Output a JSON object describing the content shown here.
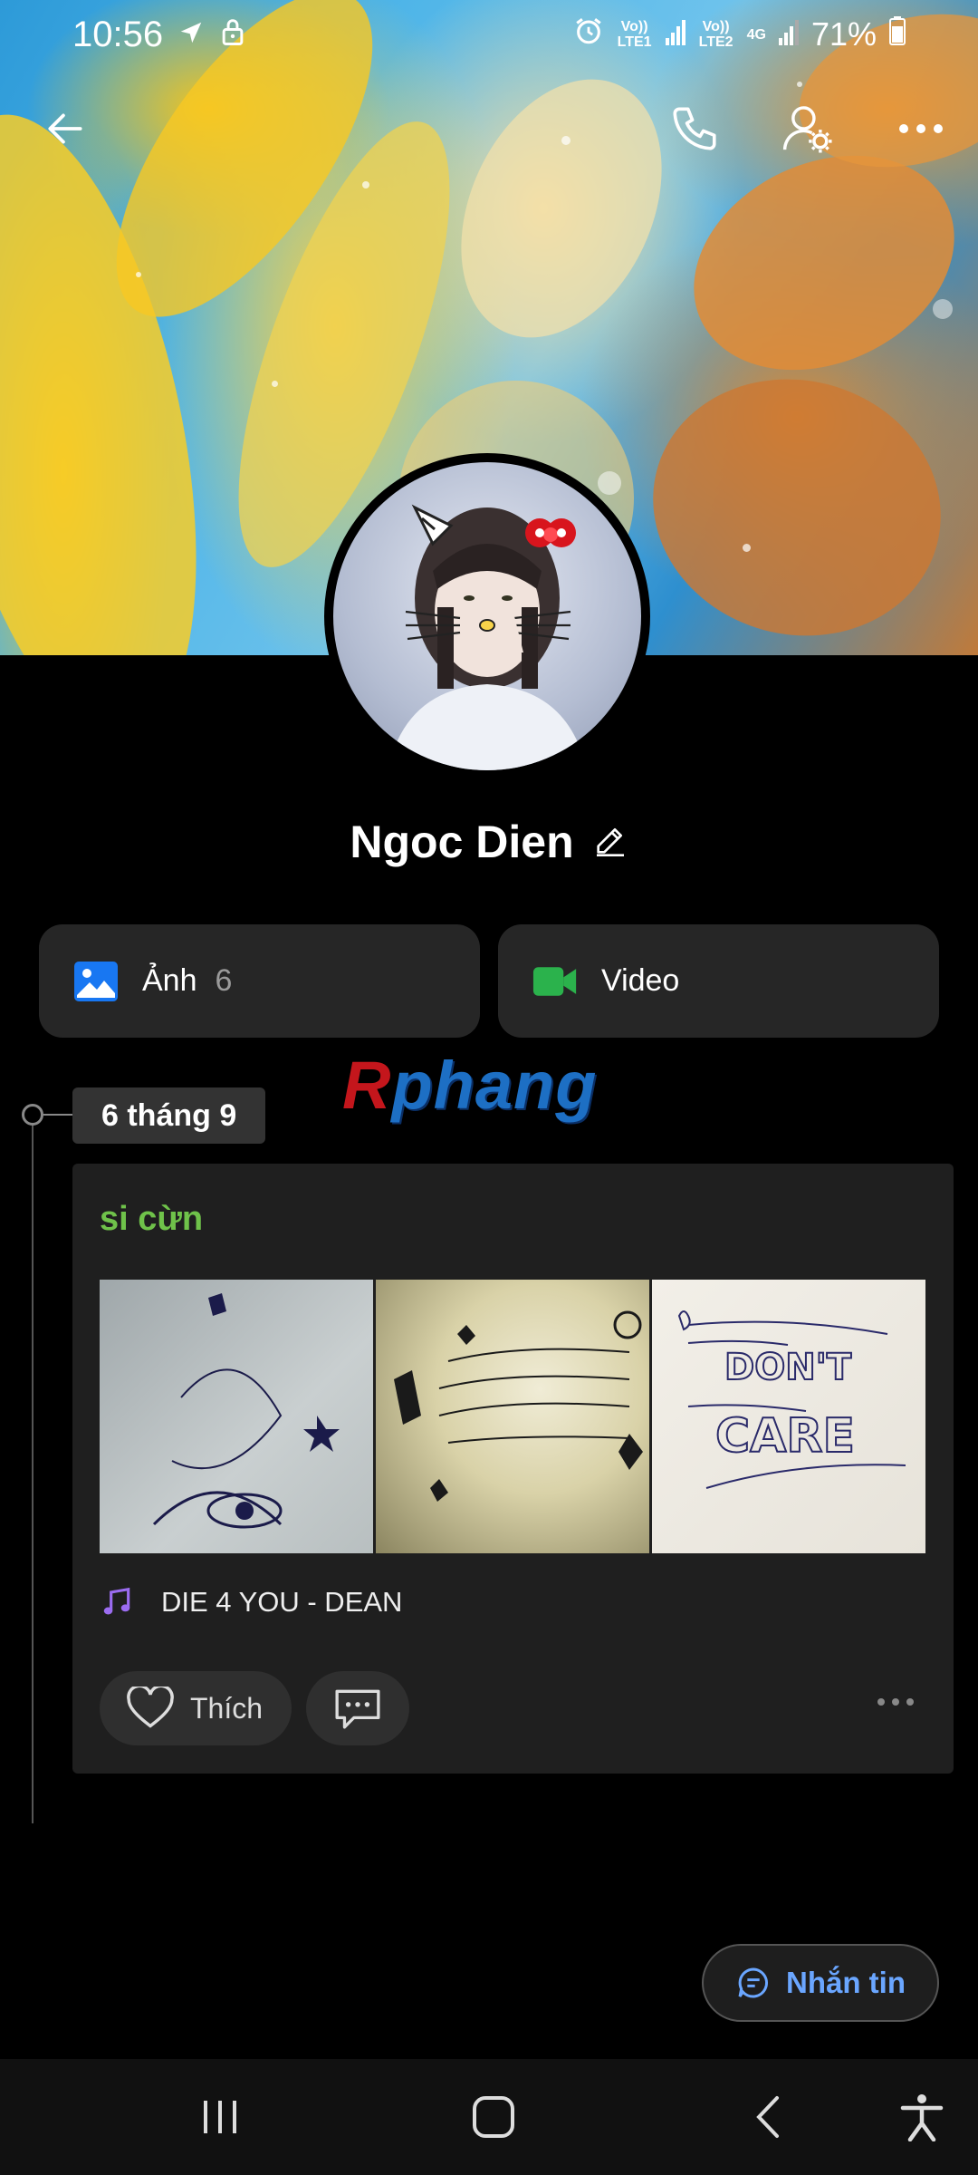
{
  "status_bar": {
    "time": "10:56",
    "volte1": "Vo)) LTE1",
    "volte2": "Vo)) LTE2",
    "network": "4G",
    "battery": "71%"
  },
  "profile": {
    "name": "Ngoc Dien"
  },
  "tiles": {
    "photos_label": "Ảnh",
    "photos_count": "6",
    "video_label": "Video"
  },
  "watermark": {
    "first": "R",
    "rest": "phang"
  },
  "timeline": {
    "date": "6 tháng 9",
    "post": {
      "text": "si cừn",
      "music": "DIE 4 YOU - DEAN",
      "like_label": "Thích"
    }
  },
  "message_button": {
    "label": "Nhắn tin"
  },
  "icons": {
    "back": "arrow-left-icon",
    "call": "phone-icon",
    "settings": "user-settings-icon",
    "more": "more-dots-icon",
    "photo": "image-icon",
    "video": "video-camera-icon",
    "edit": "pencil-icon",
    "music": "music-note-icon",
    "like": "heart-icon",
    "comment": "comment-icon",
    "chat": "chat-bubble-icon"
  },
  "colors": {
    "accent_blue": "#1877f2",
    "video_green": "#2bb24c",
    "status_green": "#6fc24a",
    "link_blue": "#6aa6ff",
    "music_purple": "#9b6cf0"
  }
}
